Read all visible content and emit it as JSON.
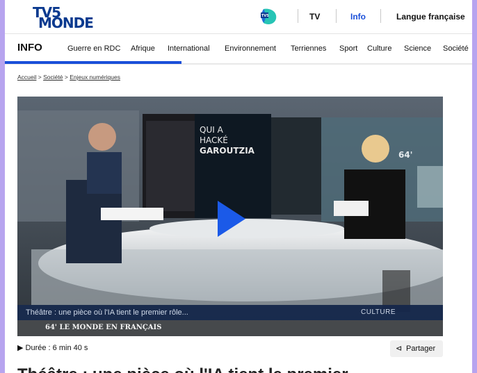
{
  "header": {
    "logo_line1": "TV5",
    "logo_line2": "MONDE",
    "links": [
      {
        "label": "TV"
      },
      {
        "label": "Info",
        "active": true
      },
      {
        "label": "Langue française"
      }
    ],
    "active_color": "#1a4fd9"
  },
  "nav": {
    "section": "INFO",
    "items": [
      "Guerre en RDC",
      "Afrique",
      "International",
      "Environnement",
      "Terriennes",
      "Sport",
      "Culture",
      "Science",
      "Société"
    ]
  },
  "breadcrumb": {
    "items": [
      "Accueil",
      "Société",
      "Enjeux numériques"
    ],
    "separator": ">"
  },
  "video": {
    "lower_third_text": "Théâtre : une pièce où l'IA tient le premier rôle...",
    "category": "CULTURE",
    "brand": "64' LE MONDE EN FRANÇAIS",
    "poster_text": "QUI A HACKÉ GAROUTZIA",
    "screen_badge": "64'",
    "play_color": "#1b5ae8"
  },
  "meta": {
    "duration": "Durée : 6 min 40 s",
    "share_label": "Partager"
  },
  "headline": "Théâtre : une pièce où l'IA tient le premier"
}
